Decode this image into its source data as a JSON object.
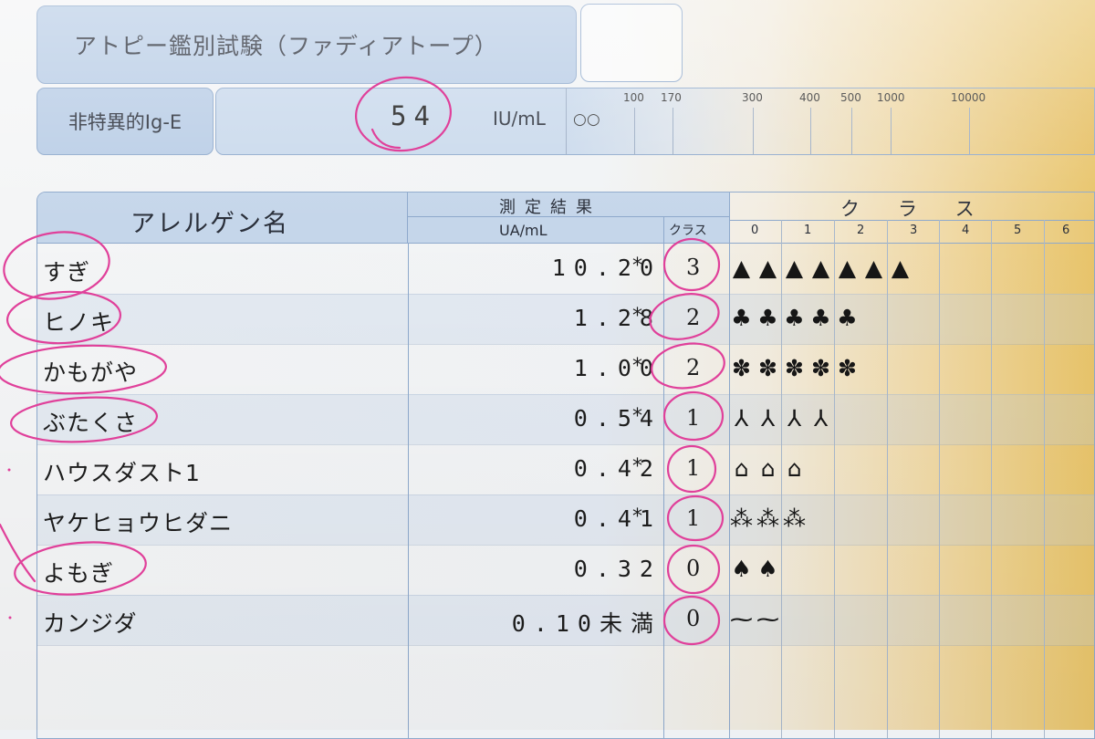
{
  "header": {
    "title": "アトピー鑑別試験（ファディアトープ）",
    "ige_label": "非特異的Ig-E",
    "ige_value": "54",
    "ige_unit": "IU/mL",
    "ige_marks": "○○",
    "ige_scale": [
      "100",
      "170",
      "300",
      "400",
      "500",
      "1000",
      "10000"
    ]
  },
  "table": {
    "col_allergen": "アレルゲン名",
    "col_result": "測定結果",
    "col_unit": "UA/mL",
    "col_class": "クラス",
    "col_class_big": "クラス",
    "class_numbers": [
      "0",
      "1",
      "2",
      "3",
      "4",
      "5",
      "6"
    ],
    "rows": [
      {
        "name": "すぎ",
        "value": "10.20",
        "mark": "*",
        "cls": "3",
        "icon": "cedar-tree-icon",
        "icon_char": "▲",
        "icon_count": 7
      },
      {
        "name": "ヒノキ",
        "value": "1.28",
        "mark": "*",
        "cls": "2",
        "icon": "cypress-tree-icon",
        "icon_char": "♣",
        "icon_count": 5
      },
      {
        "name": "かもがや",
        "value": "1.00",
        "mark": "*",
        "cls": "2",
        "icon": "grass-icon",
        "icon_char": "✽",
        "icon_count": 5
      },
      {
        "name": "ぶたくさ",
        "value": "0.54",
        "mark": "*",
        "cls": "1",
        "icon": "ragweed-icon",
        "icon_char": "⅄",
        "icon_count": 4
      },
      {
        "name": "ハウスダスト1",
        "value": "0.42",
        "mark": "*",
        "cls": "1",
        "icon": "house-icon",
        "icon_char": "⌂",
        "icon_count": 3
      },
      {
        "name": "ヤケヒョウヒダニ",
        "value": "0.41",
        "mark": "*",
        "cls": "1",
        "icon": "mite-icon",
        "icon_char": "⁂",
        "icon_count": 3
      },
      {
        "name": "よもぎ",
        "value": "0.32",
        "mark": "",
        "cls": "0",
        "icon": "mugwort-icon",
        "icon_char": "♠",
        "icon_count": 2
      },
      {
        "name": "カンジダ",
        "value": "0.10未満",
        "mark": "",
        "cls": "0",
        "icon": "candida-icon",
        "icon_char": "⁓",
        "icon_count": 2
      }
    ]
  },
  "colors": {
    "header_blue": "#b9cde6",
    "border_blue": "#8ea9cc",
    "highlight_pink": "#e0409a",
    "gradient_yellow": "#e6bf62"
  }
}
